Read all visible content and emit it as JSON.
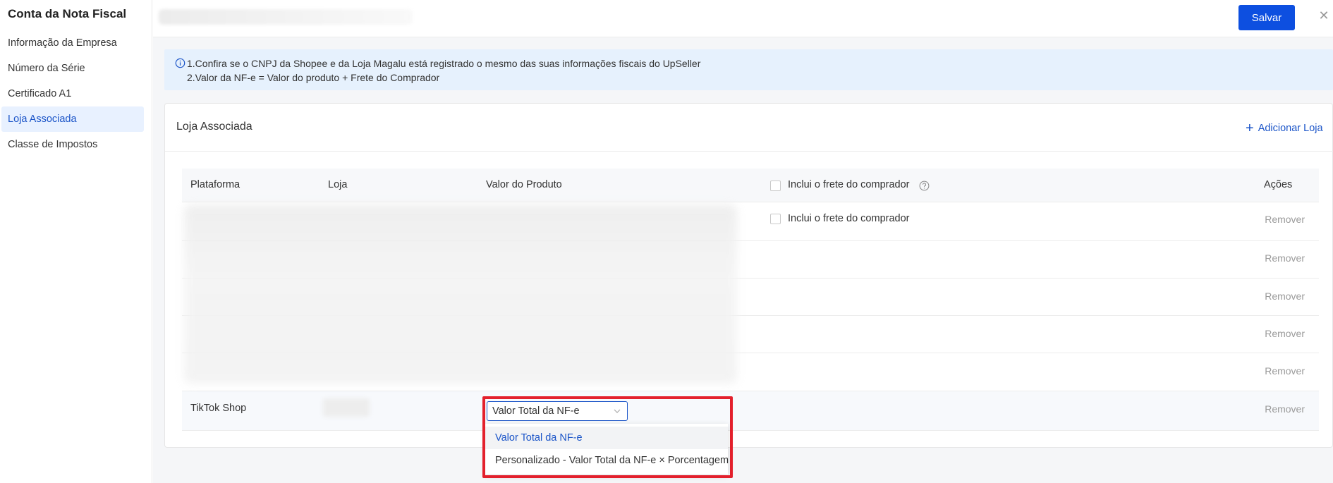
{
  "sidebar": {
    "title": "Conta da Nota Fiscal",
    "items": [
      {
        "label": "Informação da Empresa"
      },
      {
        "label": "Número da Série"
      },
      {
        "label": "Certificado A1"
      },
      {
        "label": "Loja Associada"
      },
      {
        "label": "Classe de Impostos"
      }
    ]
  },
  "toolbar": {
    "save_label": "Salvar",
    "close_glyph": "✕"
  },
  "notice": {
    "line1": "1.Confira se o CNPJ da Shopee e da Loja Magalu está registrado o mesmo das suas informações fiscais do UpSeller",
    "line2": "2.Valor da NF-e = Valor do produto + Frete do Comprador"
  },
  "card": {
    "title": "Loja Associada",
    "add_label": "Adicionar Loja"
  },
  "table": {
    "headers": {
      "platform": "Plataforma",
      "store": "Loja",
      "product_value": "Valor do Produto",
      "include_freight": "Inclui o frete do comprador",
      "actions": "Ações"
    },
    "row_checkbox_label": "Inclui o frete do comprador",
    "remove_label": "Remover",
    "last_row_platform": "TikTok Shop"
  },
  "select": {
    "value": "Valor Total da NF-e",
    "options": [
      "Valor Total da NF-e",
      "Personalizado - Valor Total da NF-e × Porcentagem"
    ]
  },
  "colors": {
    "accent": "#0d4fe0",
    "highlight": "#e3202c",
    "notice_bg": "#e6f1fd"
  }
}
